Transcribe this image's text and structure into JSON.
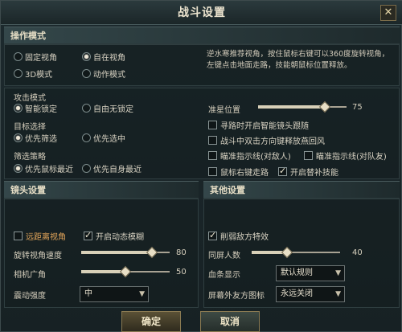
{
  "window": {
    "title": "战斗设置",
    "close_label": "✕"
  },
  "operation": {
    "header": "操作模式",
    "modes": [
      {
        "label": "固定视角",
        "selected": false
      },
      {
        "label": "自在视角",
        "selected": true
      },
      {
        "label": "3D模式",
        "selected": false
      },
      {
        "label": "动作模式",
        "selected": false
      }
    ],
    "description": "逆水寒推荐视角，按住鼠标右键可以360度旋转视角，左键点击地面走路，技能朝鼠标位置释放。"
  },
  "attack": {
    "header": "攻击模式",
    "options": [
      {
        "label": "智能锁定",
        "selected": true
      },
      {
        "label": "自由无锁定",
        "selected": false
      }
    ]
  },
  "target": {
    "header": "目标选择",
    "options": [
      {
        "label": "优先筛选",
        "selected": true
      },
      {
        "label": "优先选中",
        "selected": false
      }
    ]
  },
  "filter": {
    "header": "筛选策略",
    "options": [
      {
        "label": "优先鼠标最近",
        "selected": true
      },
      {
        "label": "优先自身最近",
        "selected": false
      }
    ]
  },
  "crosshair": {
    "label": "准星位置",
    "value": "75",
    "fraction": 0.75
  },
  "right_checks": [
    {
      "label": "寻路时开启智能镜头跟随",
      "checked": false
    },
    {
      "label": "战斗中双击方向键释放燕回风",
      "checked": false
    },
    {
      "label": "瞄准指示线(对敌人)",
      "checked": false
    },
    {
      "label": "瞄准指示线(对队友)",
      "checked": false
    },
    {
      "label": "鼠标右键走路",
      "checked": false
    },
    {
      "label": "开启替补技能",
      "checked": true
    }
  ],
  "camera": {
    "header": "镜头设置",
    "far_view": {
      "label": "远距离视角",
      "checked": false
    },
    "motion_blur": {
      "label": "开启动态模糊",
      "checked": true
    },
    "rotate_speed": {
      "label": "旋转视角速度",
      "value": "80",
      "fraction": 0.8
    },
    "fov": {
      "label": "相机广角",
      "value": "50",
      "fraction": 0.5
    },
    "shake": {
      "label": "震动强度",
      "selected": "中"
    }
  },
  "other": {
    "header": "其他设置",
    "weaken_enemy": {
      "label": "削弱敌方特效",
      "checked": true
    },
    "same_screen": {
      "label": "同屏人数",
      "value": "40",
      "fraction": 0.4
    },
    "blood_display": {
      "label": "血条显示",
      "selected": "默认规则"
    },
    "offscreen_icon": {
      "label": "屏幕外友方图标",
      "selected": "永远关闭"
    }
  },
  "buttons": {
    "confirm": "确定",
    "cancel": "取消"
  },
  "colors": {
    "accent": "#e4a65a",
    "panel": "#1d2a2e"
  }
}
